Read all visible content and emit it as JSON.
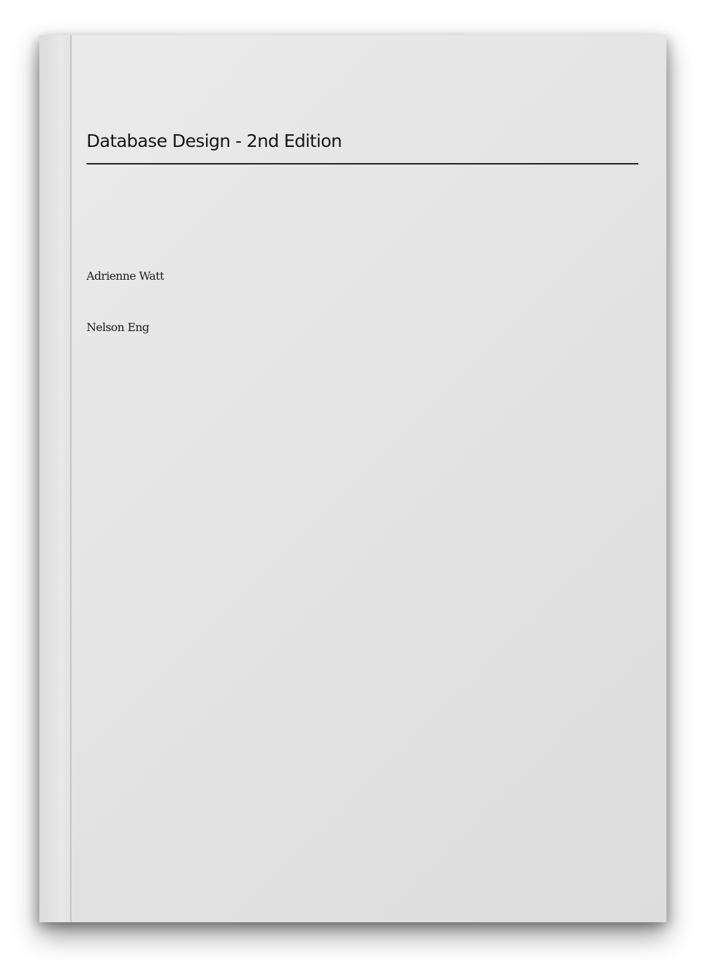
{
  "cover": {
    "title": "Database Design - 2nd Edition",
    "authors": [
      "Adrienne Watt",
      "Nelson Eng"
    ]
  },
  "colors": {
    "cover_background": "#e4e4e4",
    "text": "#151515",
    "rule": "#1f1f1f"
  }
}
